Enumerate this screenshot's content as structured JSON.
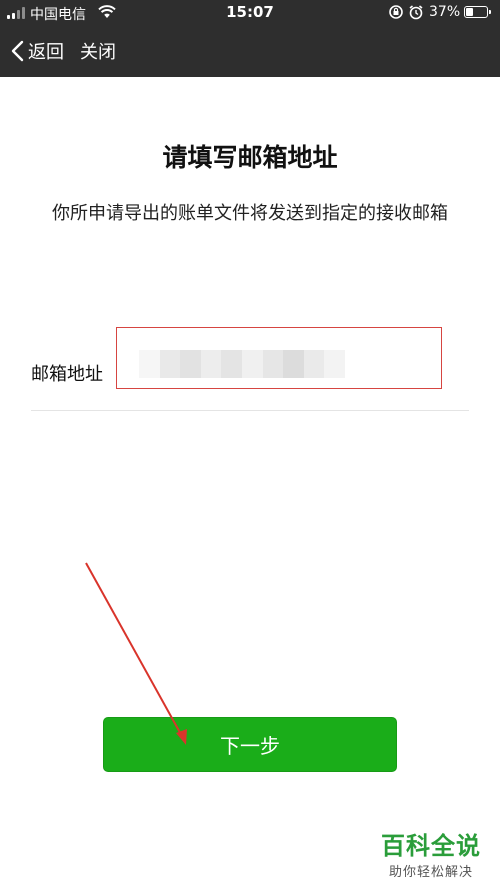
{
  "status_bar": {
    "carrier": "中国电信",
    "time": "15:07",
    "battery": "37%",
    "battery_level": 0.37
  },
  "nav": {
    "back_label": "返回",
    "close_label": "关闭"
  },
  "main": {
    "title": "请填写邮箱地址",
    "description": "你所申请导出的账单文件将发送到指定的接收邮箱",
    "email_label": "邮箱地址",
    "email_value": "",
    "next_label": "下一步"
  },
  "colors": {
    "topbar": "#2e2e2e",
    "accent_green": "#1aad19",
    "highlight_red": "#d64541"
  },
  "watermark": {
    "title": "百科全说",
    "subtitle": "助你轻松解决"
  }
}
